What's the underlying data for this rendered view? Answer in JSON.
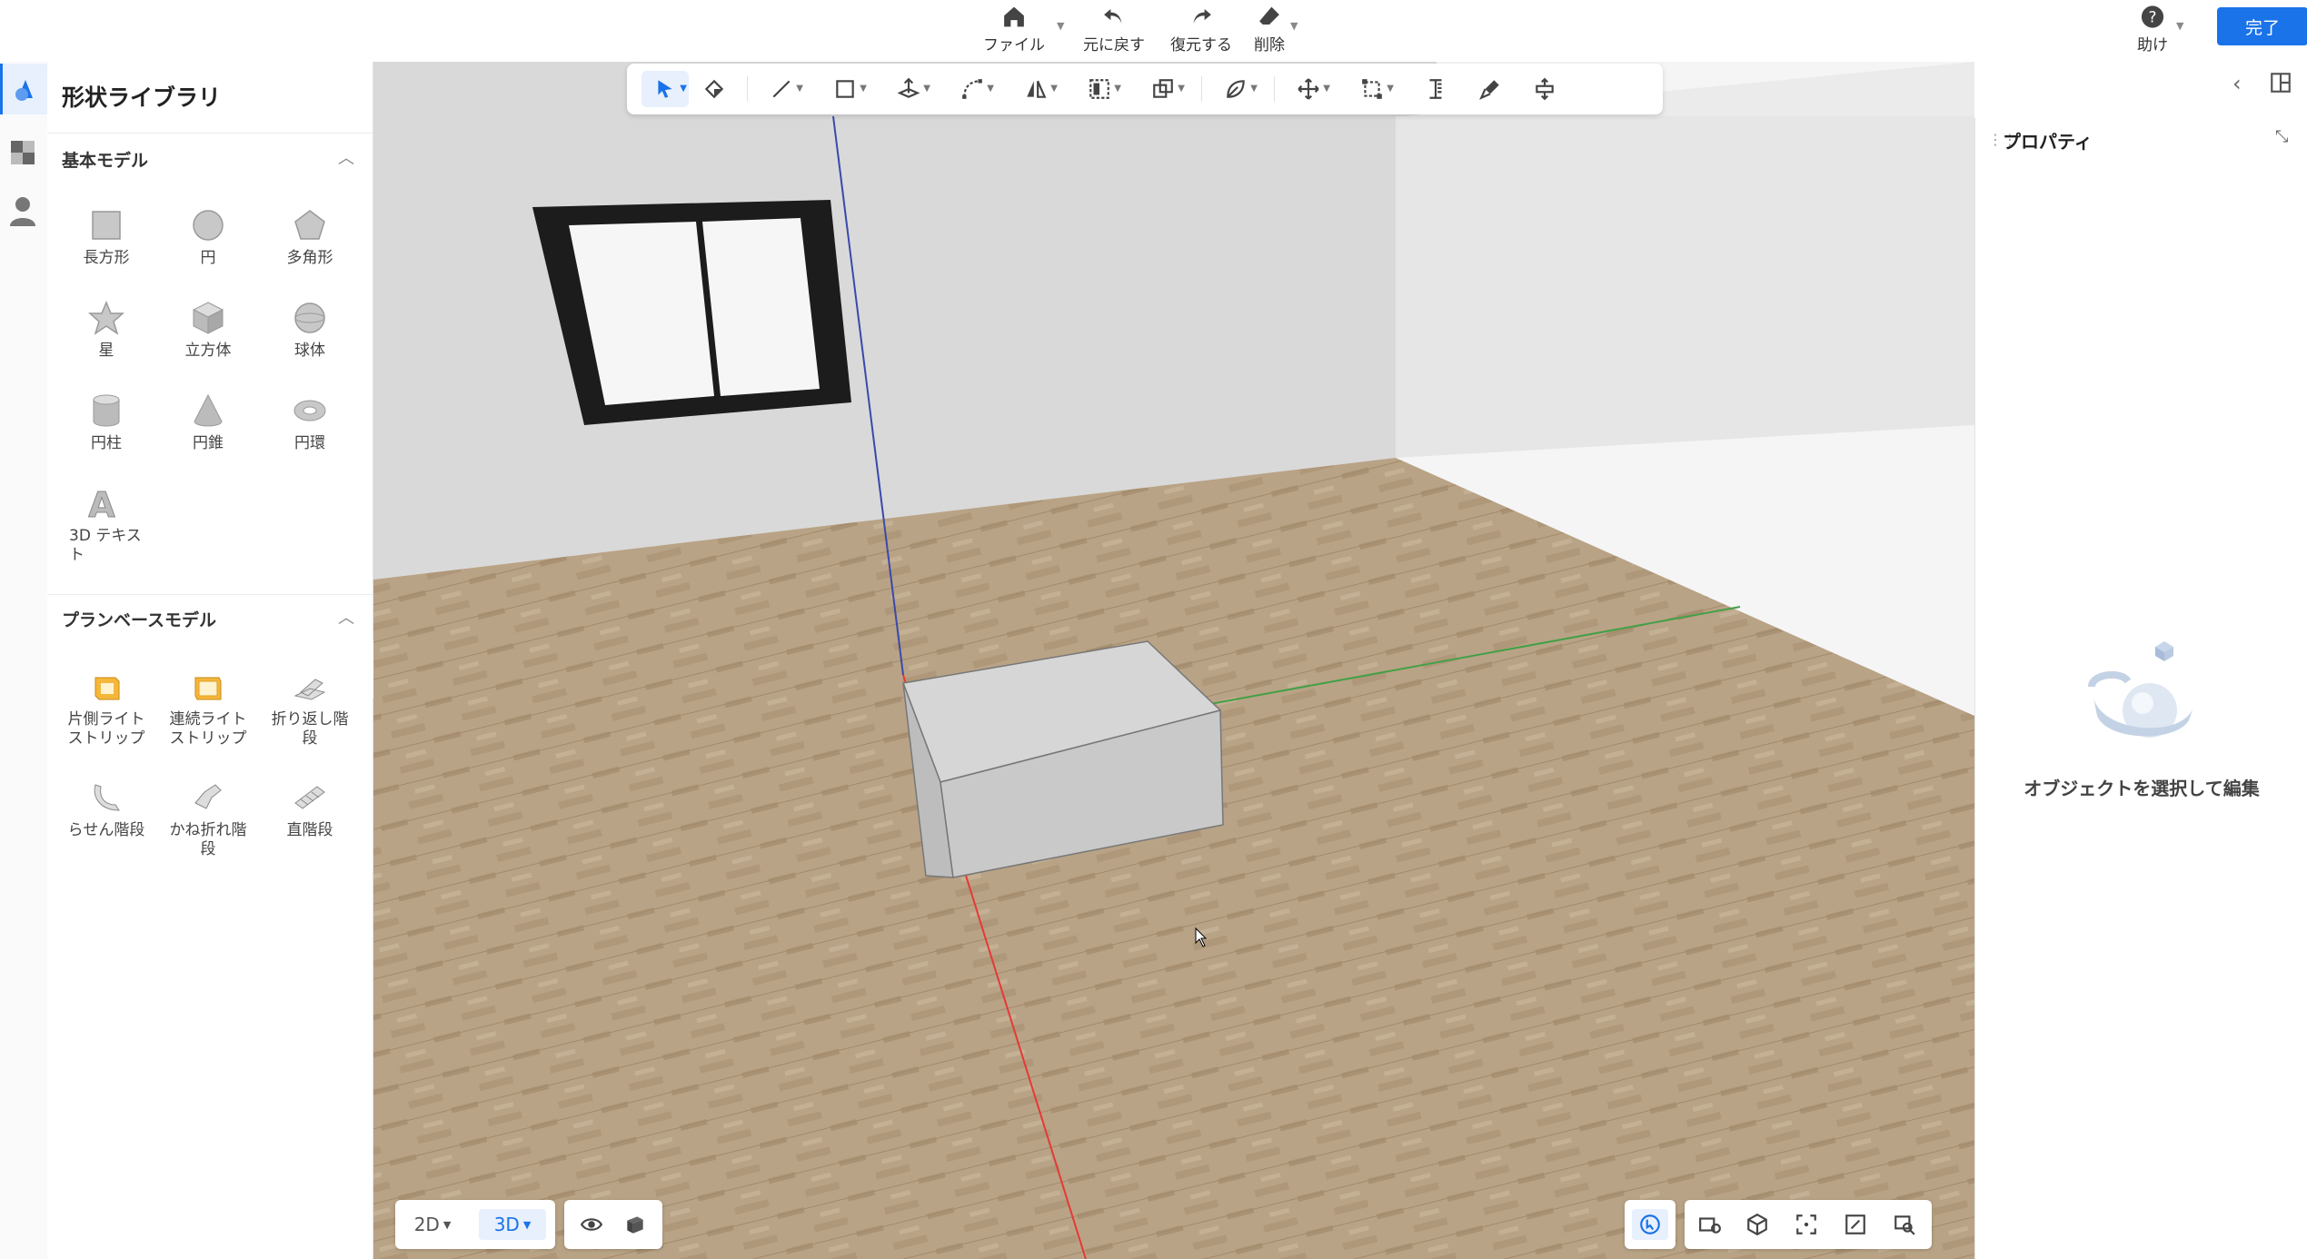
{
  "topbar": {
    "file": "ファイル",
    "undo": "元に戻す",
    "redo": "復元する",
    "delete": "削除",
    "help": "助け",
    "done": "完了"
  },
  "library": {
    "title": "形状ライブラリ",
    "basic": {
      "heading": "基本モデル",
      "items": [
        "長方形",
        "円",
        "多角形",
        "星",
        "立方体",
        "球体",
        "円柱",
        "円錐",
        "円環",
        "3D テキスト"
      ]
    },
    "plan": {
      "heading": "プランベースモデル",
      "items": [
        "片側ライトストリップ",
        "連続ライトストリップ",
        "折り返し階段",
        "らせん階段",
        "かね折れ階段",
        "直階段"
      ]
    }
  },
  "properties": {
    "title": "プロパティ",
    "empty": "オブジェクトを選択して編集"
  },
  "view": {
    "mode_2d": "2D",
    "mode_3d": "3D",
    "active_mode": "3D"
  },
  "colors": {
    "accent": "#1a73e8",
    "axis_x": "#e53935",
    "axis_y": "#43a047",
    "axis_z": "#3949ab",
    "floor": "#b9a386",
    "wall": "#d9d9d9"
  }
}
